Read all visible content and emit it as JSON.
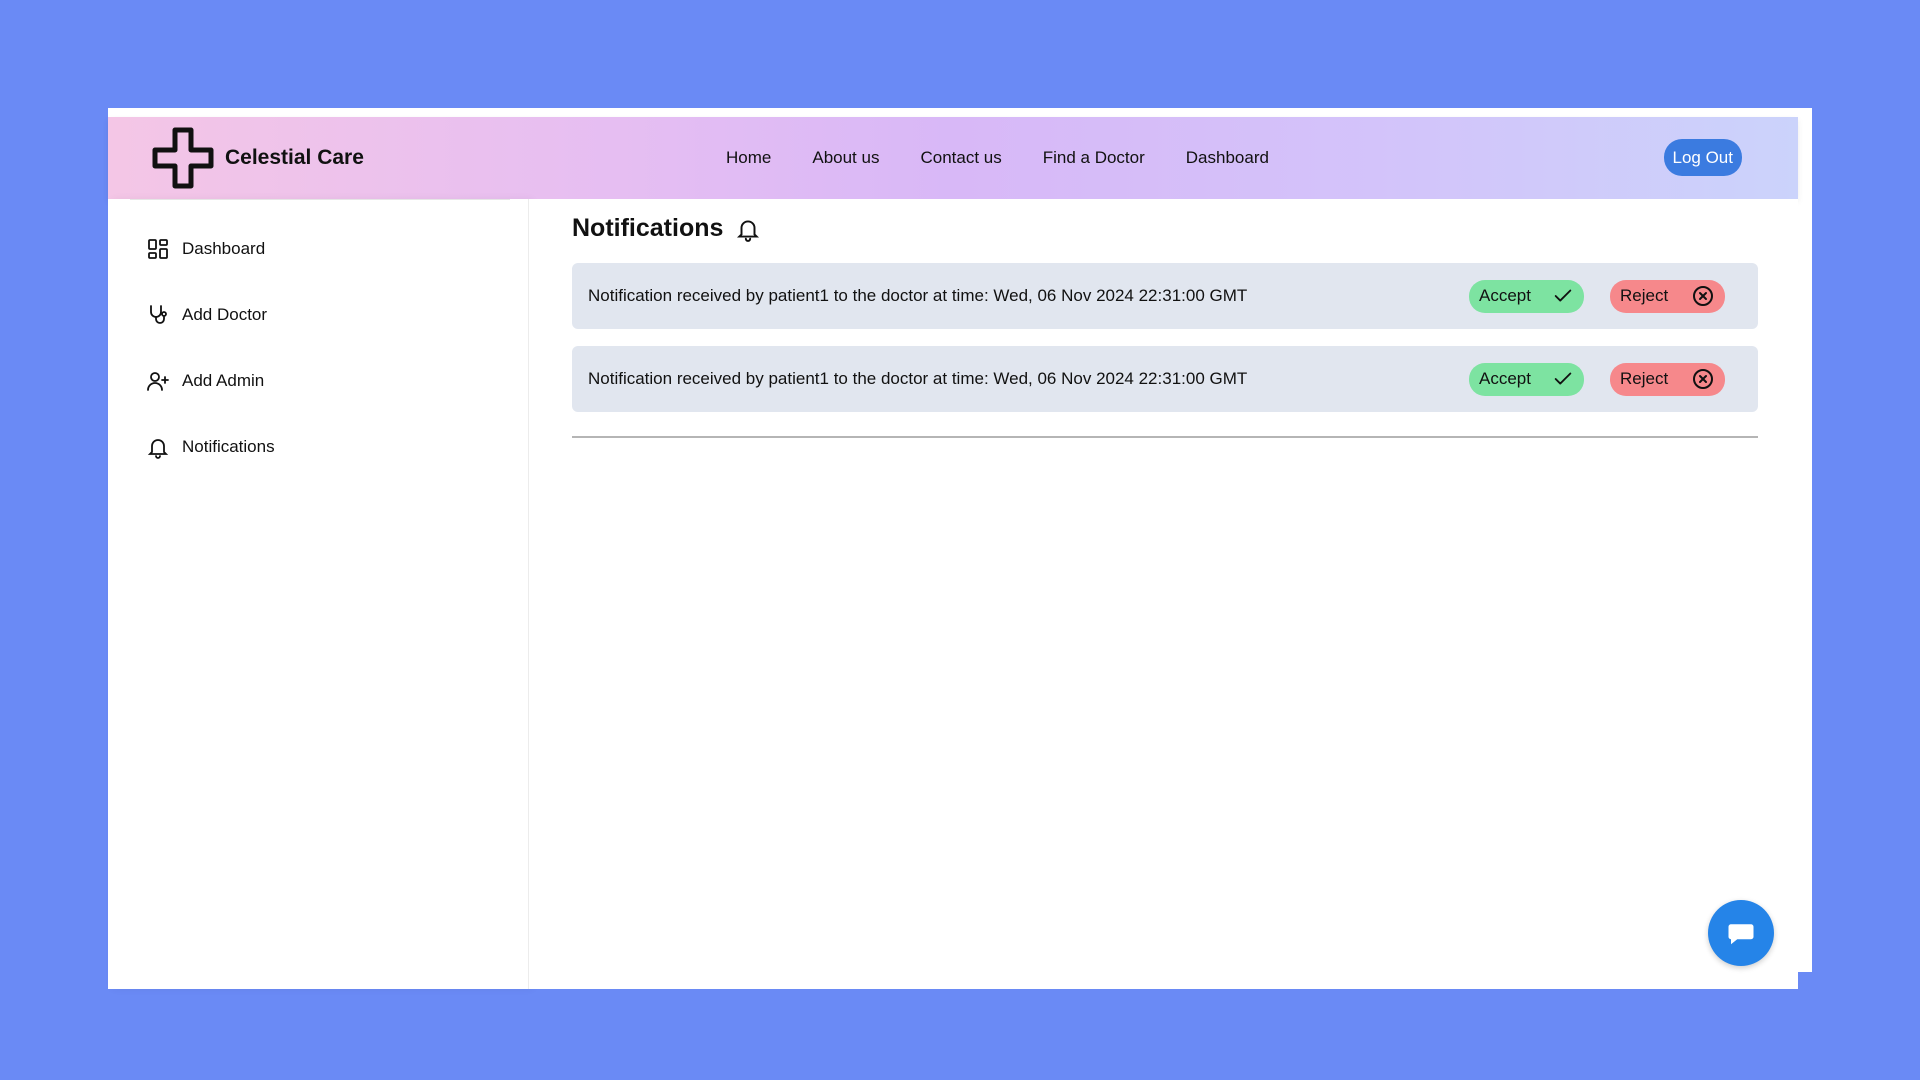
{
  "brand": {
    "name": "Celestial Care",
    "icon": "medical-cross-icon"
  },
  "nav": {
    "links": [
      "Home",
      "About us",
      "Contact us",
      "Find a Doctor",
      "Dashboard"
    ],
    "logout_label": "Log Out"
  },
  "sidebar": {
    "items": [
      {
        "label": "Dashboard",
        "icon": "dashboard-grid-icon"
      },
      {
        "label": "Add Doctor",
        "icon": "stethoscope-icon"
      },
      {
        "label": "Add Admin",
        "icon": "user-plus-icon"
      },
      {
        "label": "Notifications",
        "icon": "bell-icon"
      }
    ]
  },
  "main": {
    "title": "Notifications",
    "title_icon": "bell-icon",
    "notifications": [
      {
        "text": "Notification received by patient1 to the doctor at time: Wed, 06 Nov 2024 22:31:00 GMT",
        "accept_label": "Accept",
        "reject_label": "Reject"
      },
      {
        "text": "Notification received by patient1 to the doctor at time: Wed, 06 Nov 2024 22:31:00 GMT",
        "accept_label": "Accept",
        "reject_label": "Reject"
      }
    ]
  },
  "colors": {
    "page_background": "#6a8af5",
    "accept": "#7de3a1",
    "reject": "#f6888b",
    "logout": "#3b7be0",
    "chat_fab": "#2584e8",
    "notification_bg": "#e1e6ef"
  },
  "chat": {
    "icon": "chat-bubble-icon"
  }
}
